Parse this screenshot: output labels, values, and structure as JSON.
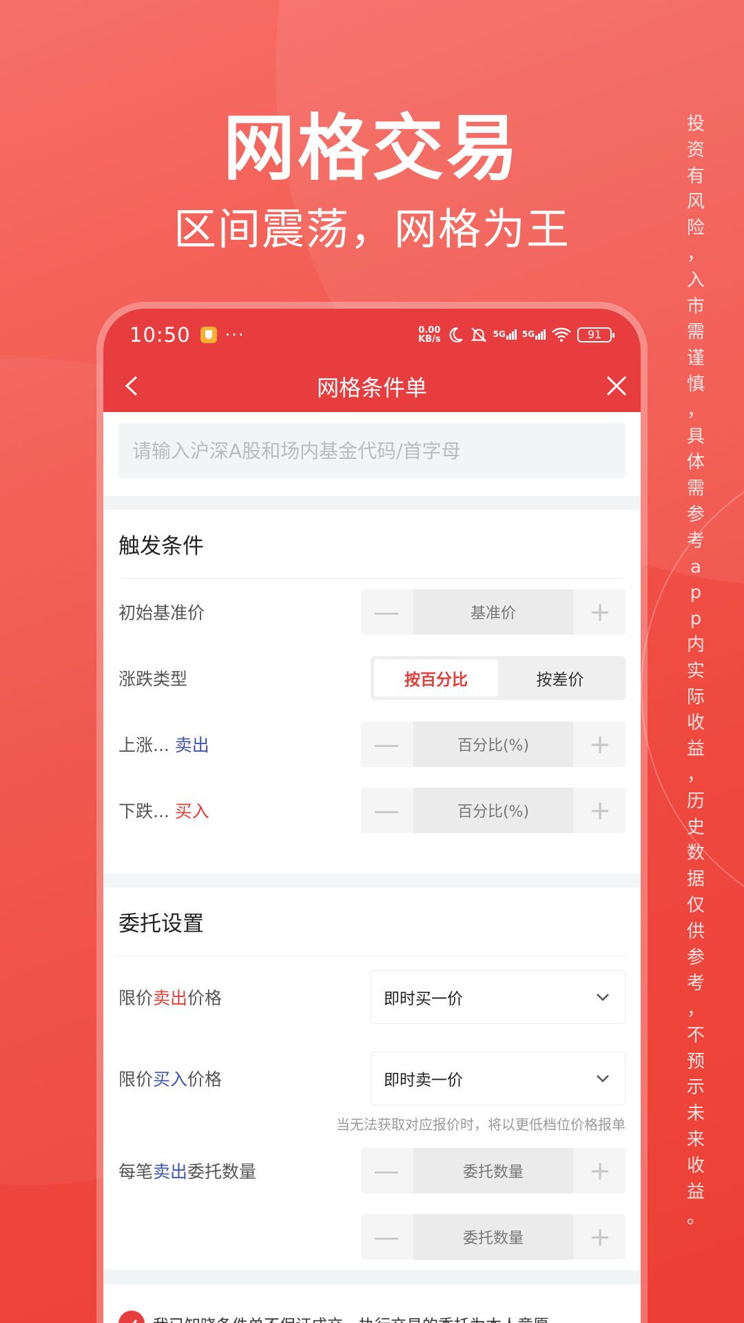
{
  "hero": {
    "title": "网格交易",
    "subtitle": "区间震荡，网格为王"
  },
  "disclaimer_chars": [
    "投",
    "资",
    "有",
    "风",
    "险",
    "，",
    "入",
    "市",
    "需",
    "谨",
    "慎",
    "，",
    "具",
    "体",
    "需",
    "参",
    "考",
    "a",
    "p",
    "p",
    "内",
    "实",
    "际",
    "收",
    "益",
    "，",
    "历",
    "史",
    "数",
    "据",
    "仅",
    "供",
    "参",
    "考",
    "，",
    "不",
    "预",
    "示",
    "未",
    "来",
    "收",
    "益",
    "。"
  ],
  "status_bar": {
    "time": "10:50",
    "more": "···",
    "net_speed_value": "0.00",
    "net_speed_unit": "KB/s",
    "signal1": "5G",
    "signal2": "5G",
    "battery": "91"
  },
  "nav": {
    "title": "网格条件单"
  },
  "search": {
    "placeholder": "请输入沪深A股和场内基金代码/首字母"
  },
  "trigger": {
    "title": "触发条件",
    "base_price_label": "初始基准价",
    "base_price_placeholder": "基准价",
    "change_type_label": "涨跌类型",
    "change_type_options": [
      "按百分比",
      "按差价"
    ],
    "rise_label_prefix": "上涨...",
    "rise_action": "卖出",
    "rise_placeholder": "百分比(%)",
    "fall_label_prefix": "下跌...",
    "fall_action": "买入",
    "fall_placeholder": "百分比(%)",
    "minus": "—",
    "plus": "+"
  },
  "order": {
    "title": "委托设置",
    "sell_price_label_pre": "限价",
    "sell_price_label_act": "卖出",
    "sell_price_label_post": "价格",
    "sell_price_value": "即时买一价",
    "buy_price_label_pre": "限价",
    "buy_price_label_act": "买入",
    "buy_price_label_post": "价格",
    "buy_price_value": "即时卖一价",
    "hint": "当无法获取对应报价时，将以更低档位价格报单",
    "qty_label_pre": "每笔",
    "qty_label_act": "卖出",
    "qty_label_post": "委托数量",
    "qty_placeholder": "委托数量",
    "qty2_placeholder": "委托数量"
  },
  "footer": {
    "agreement": "我已知晓条件单不保证成交，执行交易的委托为本人意愿"
  },
  "colors": {
    "brand_red": "#e83d3f",
    "sell_blue": "#3d56b5",
    "buy_red": "#e33d3a"
  }
}
